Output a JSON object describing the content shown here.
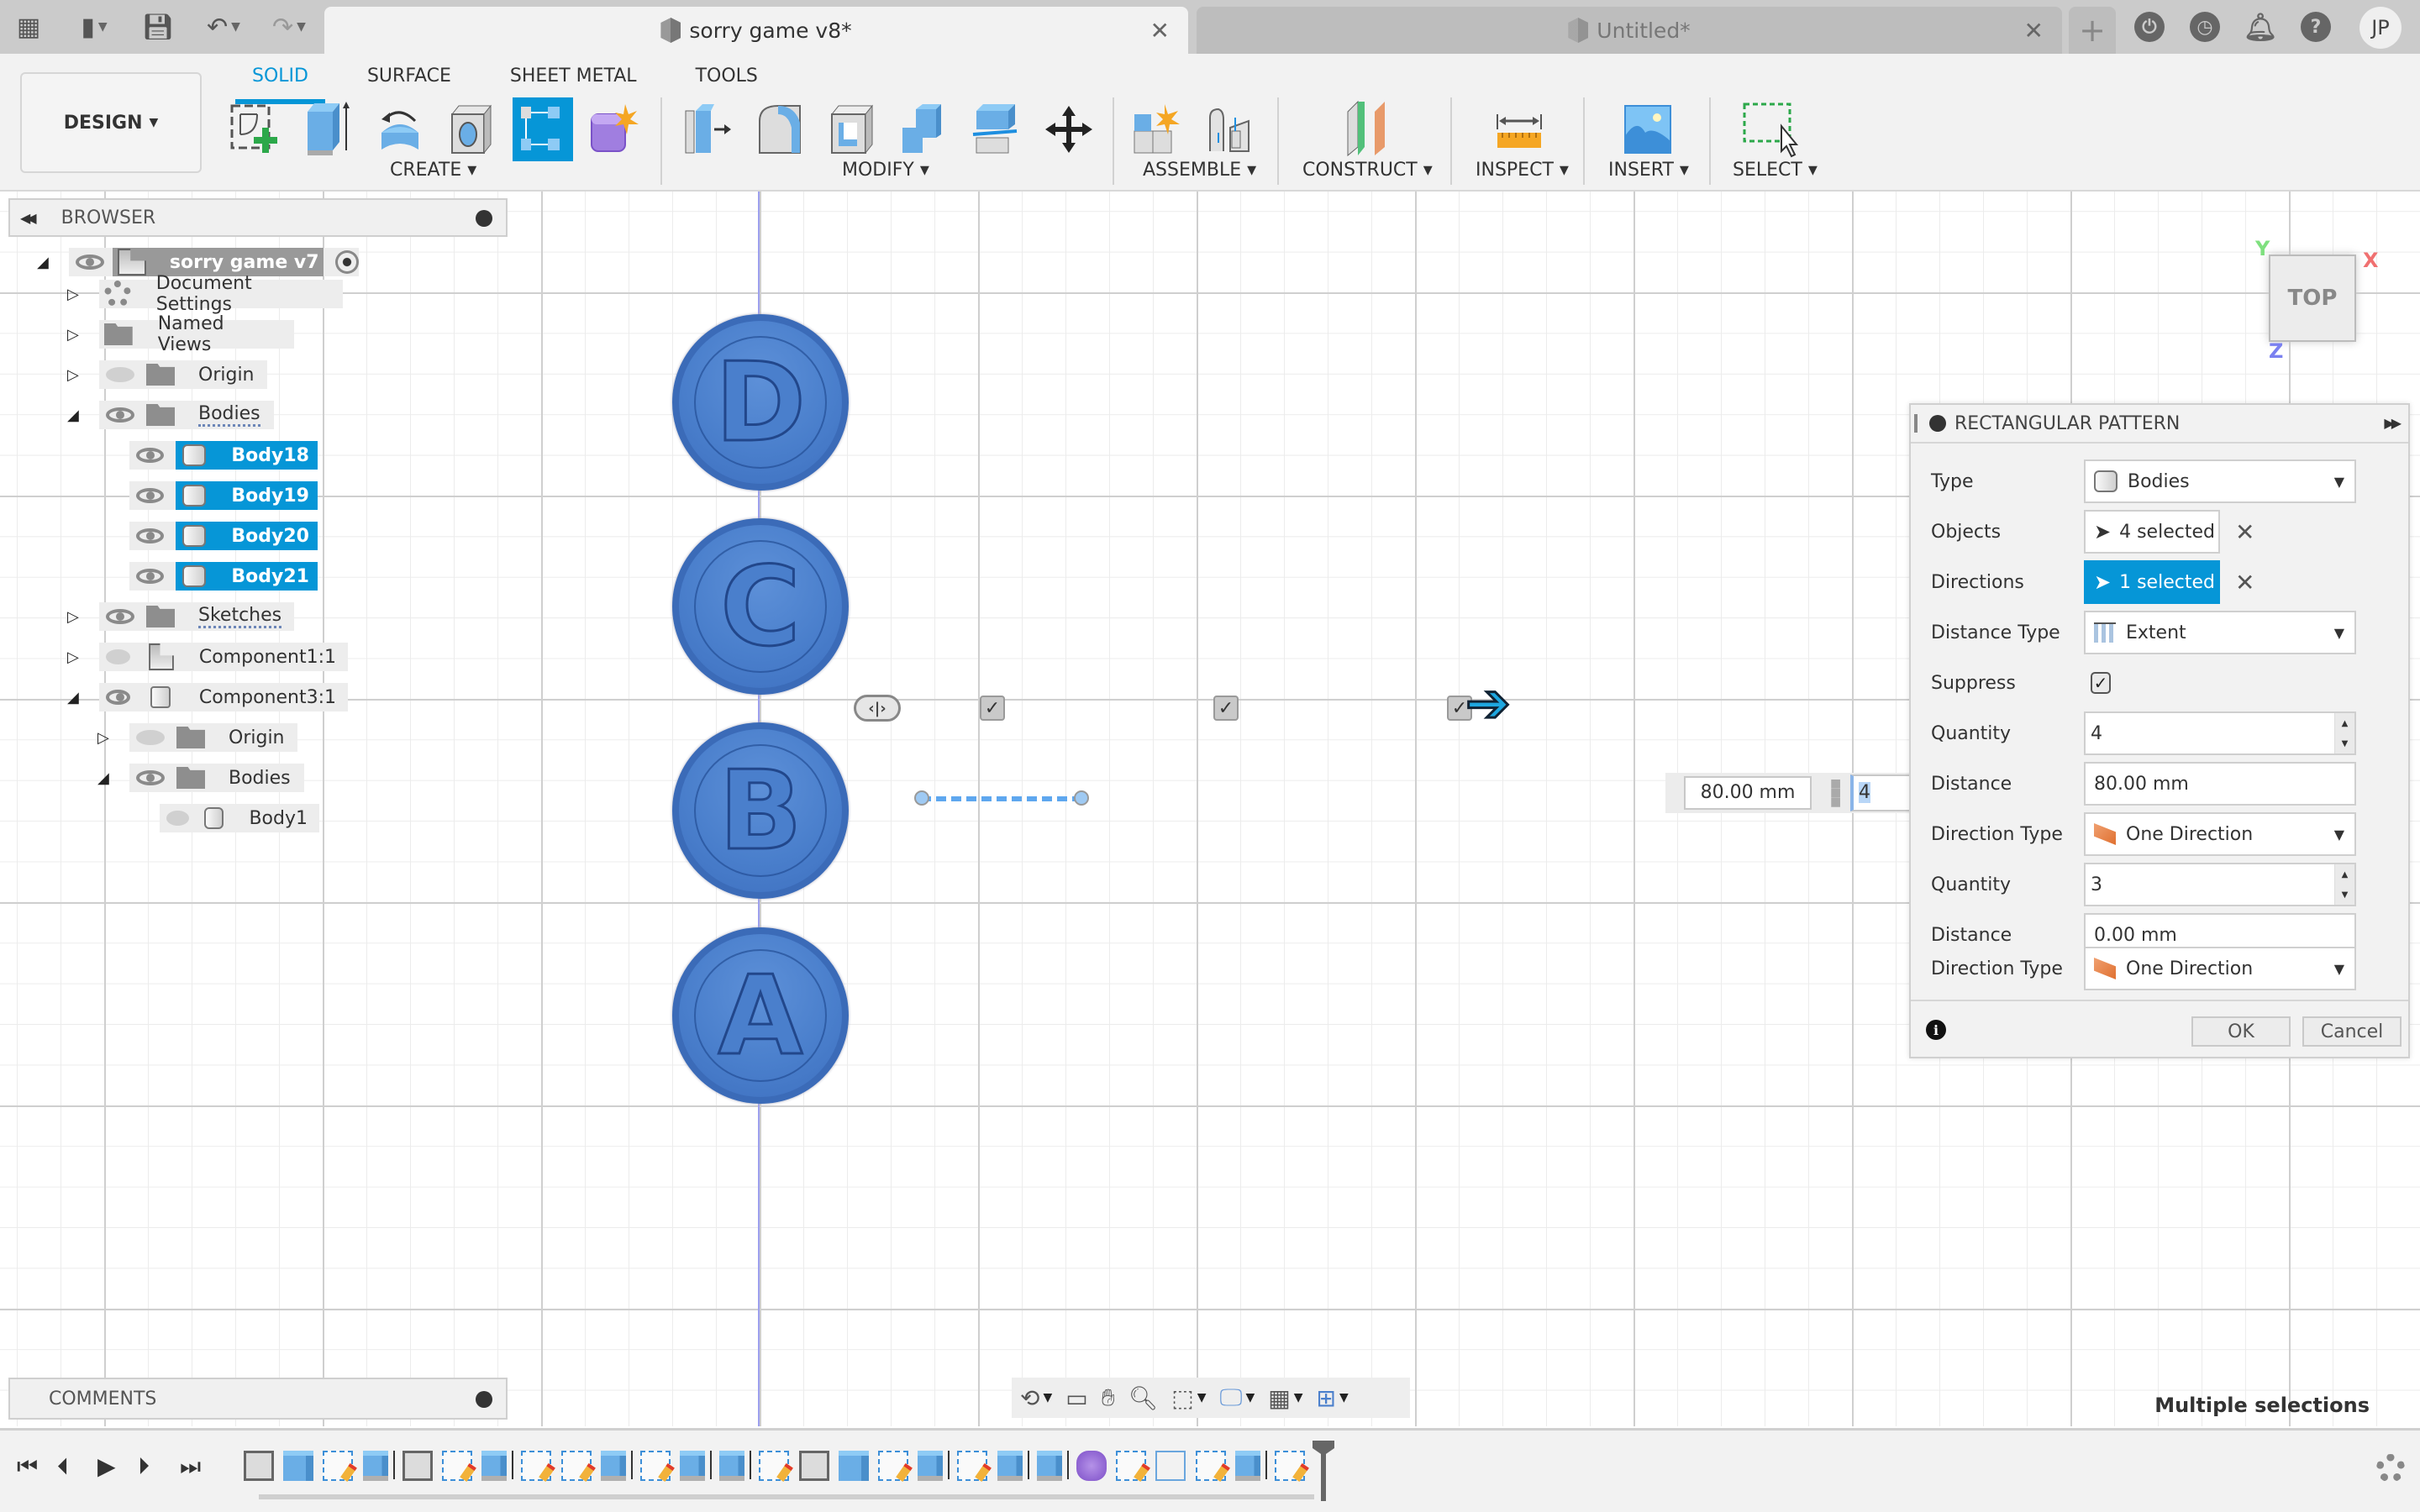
{
  "titlebar": {
    "quick_icons": [
      "grid-icon",
      "file-icon",
      "save-icon",
      "undo-icon",
      "redo-icon"
    ],
    "tabs": [
      {
        "label": "sorry game v8*",
        "active": true
      },
      {
        "label": "Untitled*",
        "active": false
      }
    ],
    "new_tab_label": "+",
    "right_icons": [
      "extensions-icon",
      "job-status-icon",
      "notifications-icon",
      "help-icon"
    ],
    "user_initials": "JP"
  },
  "ribbon": {
    "workspace": "DESIGN",
    "tabs": [
      {
        "label": "SOLID",
        "active": true
      },
      {
        "label": "SURFACE",
        "active": false
      },
      {
        "label": "SHEET METAL",
        "active": false
      },
      {
        "label": "TOOLS",
        "active": false
      }
    ],
    "groups": [
      {
        "label": "CREATE",
        "tools": [
          "create-sketch",
          "extrude",
          "revolve",
          "hole",
          "rectangular-pattern",
          "create-form"
        ]
      },
      {
        "label": "MODIFY",
        "tools": [
          "press-pull",
          "fillet",
          "shell",
          "combine",
          "split-body",
          "move-copy"
        ]
      },
      {
        "label": "ASSEMBLE",
        "tools": [
          "new-component",
          "joint"
        ]
      },
      {
        "label": "CONSTRUCT",
        "tools": [
          "offset-plane"
        ]
      },
      {
        "label": "INSPECT",
        "tools": [
          "measure"
        ]
      },
      {
        "label": "INSERT",
        "tools": [
          "insert-canvas"
        ]
      },
      {
        "label": "SELECT",
        "tools": [
          "window-select"
        ]
      }
    ],
    "active_tool": "rectangular-pattern"
  },
  "browser": {
    "title": "BROWSER",
    "root": "sorry game v7",
    "items": [
      {
        "label": "Document Settings",
        "icon": "gear-icon",
        "expanded": false,
        "visible": null
      },
      {
        "label": "Named Views",
        "icon": "folder-icon",
        "expanded": false,
        "visible": null
      },
      {
        "label": "Origin",
        "icon": "folder-icon",
        "expanded": false,
        "visible": false
      },
      {
        "label": "Bodies",
        "icon": "folder-icon",
        "expanded": true,
        "visible": true
      },
      {
        "label": "Body18",
        "icon": "body-icon",
        "selected": true,
        "visible": true
      },
      {
        "label": "Body19",
        "icon": "body-icon",
        "selected": true,
        "visible": true
      },
      {
        "label": "Body20",
        "icon": "body-icon",
        "selected": true,
        "visible": true
      },
      {
        "label": "Body21",
        "icon": "body-icon",
        "selected": true,
        "visible": true
      },
      {
        "label": "Sketches",
        "icon": "folder-icon",
        "expanded": false,
        "visible": true
      },
      {
        "label": "Component1:1",
        "icon": "component-icon",
        "expanded": false,
        "visible": false
      },
      {
        "label": "Component3:1",
        "icon": "component-icon",
        "expanded": true,
        "visible": true
      },
      {
        "label": "Origin",
        "icon": "folder-icon",
        "expanded": false,
        "visible": false
      },
      {
        "label": "Bodies",
        "icon": "folder-icon",
        "expanded": true,
        "visible": true
      },
      {
        "label": "Body1",
        "icon": "body-icon",
        "visible": false
      }
    ]
  },
  "comments": {
    "title": "COMMENTS"
  },
  "viewport": {
    "coins": [
      "D",
      "C",
      "B",
      "A"
    ],
    "dimension_value": "80.00 mm",
    "quantity_value": "4",
    "viewcube": {
      "face": "TOP",
      "axes": {
        "x": "X",
        "y": "Y",
        "z": "Z"
      }
    },
    "status": "Multiple selections",
    "nav_tools": [
      "orbit-icon",
      "look-at-icon",
      "pan-icon",
      "zoom-icon",
      "fit-icon",
      "display-settings-icon",
      "grid-icon",
      "viewports-icon"
    ]
  },
  "dialog": {
    "title": "RECTANGULAR PATTERN",
    "fields": {
      "type": {
        "label": "Type",
        "value": "Bodies"
      },
      "objects": {
        "label": "Objects",
        "value": "4 selected"
      },
      "directions": {
        "label": "Directions",
        "value": "1 selected"
      },
      "distance_type": {
        "label": "Distance Type",
        "value": "Extent"
      },
      "suppress": {
        "label": "Suppress",
        "checked": true,
        "glyph": "✓"
      },
      "quantity1": {
        "label": "Quantity",
        "value": "4"
      },
      "distance1": {
        "label": "Distance",
        "value": "80.00 mm"
      },
      "direction_type1": {
        "label": "Direction Type",
        "value": "One Direction"
      },
      "quantity2": {
        "label": "Quantity",
        "value": "3"
      },
      "distance2": {
        "label": "Distance",
        "value": "0.00 mm"
      },
      "direction_type2": {
        "label": "Direction Type",
        "value": "One Direction"
      }
    },
    "ok_label": "OK",
    "cancel_label": "Cancel"
  },
  "timeline": {
    "items": [
      "body",
      "newbody",
      "sketch",
      "extrude",
      "body",
      "sketch",
      "extrude",
      "sketch",
      "sketch",
      "extrude",
      "sketch",
      "extrude",
      "extrude",
      "sketch",
      "body",
      "newbody",
      "sketch",
      "extrude",
      "sketch",
      "extrude",
      "extrude",
      "form",
      "sketch",
      "pattern",
      "sketch",
      "extrude",
      "sketch"
    ]
  }
}
